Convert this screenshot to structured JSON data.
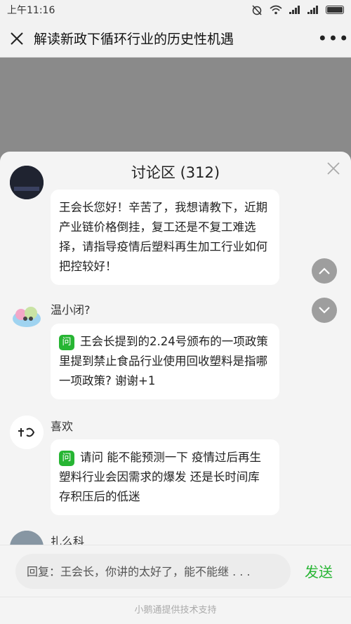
{
  "status_bar": {
    "time": "上午11:16"
  },
  "nav": {
    "title": "解读新政下循环行业的历史性机遇",
    "more": "•••"
  },
  "discussion": {
    "title": "讨论区 (312)",
    "comments": [
      {
        "text": "王会长您好！辛苦了，我想请教下，近期产业链价格倒挂，复工还是不复工难选择，请指导疫情后塑料再生加工行业如何把控较好！"
      },
      {
        "user": "温小闭?",
        "badge": "问",
        "text": "王会长提到的2.24号颁布的一项政策里提到禁止食品行业使用回收塑料是指哪一项政策? 谢谢+1"
      },
      {
        "user": "喜欢",
        "badge": "问",
        "text": "请问 能不能预测一下 疫情过后再生塑料行业会因需求的爆发 还是长时间库存积压后的低迷"
      },
      {
        "user": "扎么科"
      }
    ]
  },
  "reply": {
    "placeholder": "回复：王会长，你讲的太好了，能不能继 . . .",
    "send_label": "发送"
  },
  "footer": {
    "text": "小鹅通提供技术支持"
  },
  "colors": {
    "accent": "#27b533"
  }
}
